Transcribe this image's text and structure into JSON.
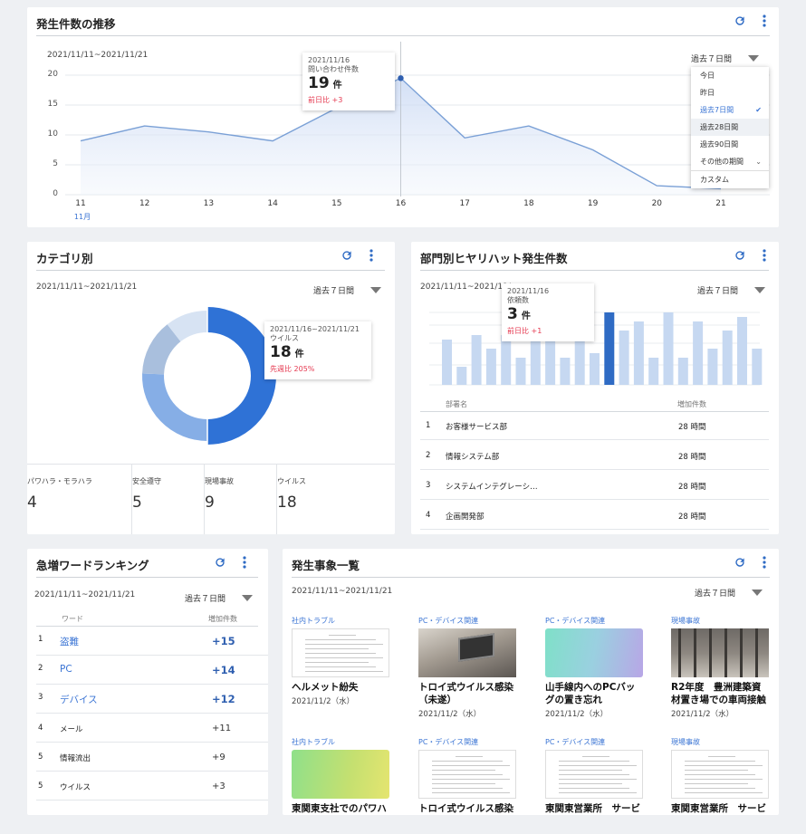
{
  "trend": {
    "title": "発生件数の推移",
    "date_range": "2021/11/11~2021/11/21",
    "period": "過去７日間",
    "y_ticks": [
      "20",
      "15",
      "10",
      "5",
      "0"
    ],
    "x_ticks": [
      "11",
      "12",
      "13",
      "14",
      "15",
      "16",
      "17",
      "18",
      "19",
      "20",
      "21"
    ],
    "x_month": "11月",
    "tooltip": {
      "date": "2021/11/16",
      "label": "問い合わせ件数",
      "value": "19",
      "unit": "件",
      "delta": "前日比 +3"
    },
    "dropdown": [
      {
        "label": "今日",
        "selected": false
      },
      {
        "label": "昨日",
        "selected": false
      },
      {
        "label": "過去7日間",
        "selected": true,
        "mark": "✔"
      },
      {
        "label": "過去28日間",
        "selected": false
      },
      {
        "label": "過去90日間",
        "selected": false
      },
      {
        "label": "その他の期間",
        "selected": false,
        "mark": "⌄"
      },
      {
        "label": "カスタム",
        "selected": false
      }
    ]
  },
  "category": {
    "title": "カテゴリ別",
    "date_range": "2021/11/11~2021/11/21",
    "period": "過去７日間",
    "tooltip": {
      "date": "2021/11/16~2021/11/21",
      "label": "ウイルス",
      "value": "18",
      "unit": "件",
      "delta": "先週比 205%"
    },
    "stats": [
      {
        "label": "パワハラ・モラハラ",
        "value": "4"
      },
      {
        "label": "安全遵守",
        "value": "5"
      },
      {
        "label": "現場事故",
        "value": "9"
      },
      {
        "label": "ウイルス",
        "value": "18"
      }
    ]
  },
  "department": {
    "title": "部門別ヒヤリハット発生件数",
    "date_range": "2021/11/11~2021/11/",
    "period": "過去７日間",
    "tooltip": {
      "date": "2021/11/16",
      "label": "依頼数",
      "value": "3",
      "unit": "件",
      "delta": "前日比 +1"
    },
    "col_name": "部署名",
    "col_count": "増加件数",
    "rows": [
      {
        "rank": "1",
        "name": "お客様サービス部",
        "count": "28 時間"
      },
      {
        "rank": "2",
        "name": "情報システム部",
        "count": "28 時間"
      },
      {
        "rank": "3",
        "name": "システムインテグレーシ…",
        "count": "28 時間"
      },
      {
        "rank": "4",
        "name": "企画開発部",
        "count": "28 時間"
      }
    ]
  },
  "ranking": {
    "title": "急増ワードランキング",
    "date_range": "2021/11/11~2021/11/21",
    "period": "過去７日間",
    "col_word": "ワード",
    "col_count": "増加件数",
    "rows": [
      {
        "rank": "1",
        "word": "盗難",
        "count": "+15",
        "highlight": true
      },
      {
        "rank": "2",
        "word": "PC",
        "count": "+14",
        "highlight": true
      },
      {
        "rank": "3",
        "word": "デバイス",
        "count": "+12",
        "highlight": true
      },
      {
        "rank": "4",
        "word": "メール",
        "count": "+11",
        "highlight": false
      },
      {
        "rank": "5",
        "word": "情報流出",
        "count": "+9",
        "highlight": false
      },
      {
        "rank": "5",
        "word": "ウイルス",
        "count": "+3",
        "highlight": false
      }
    ]
  },
  "events": {
    "title": "発生事象一覧",
    "date_range": "2021/11/11~2021/11/21",
    "period": "過去７日間",
    "items": [
      {
        "category": "社内トラブル",
        "title": "ヘルメット紛失",
        "date": "2021/11/2（水）",
        "thumb": "doc"
      },
      {
        "category": "PC・デバイス関連",
        "title": "トロイ式ウイルス感染（未遂）",
        "date": "2021/11/2（水）",
        "thumb": "photo-desk"
      },
      {
        "category": "PC・デバイス関連",
        "title": "山手線内へのPCバッグの置き忘れ",
        "date": "2021/11/2（水）",
        "thumb": "gradient-teal"
      },
      {
        "category": "現場事故",
        "title": "R2年度　豊洲建築資材置き場での車両接触",
        "date": "2021/11/2（水）",
        "thumb": "photo-building"
      },
      {
        "category": "社内トラブル",
        "title": "東関東支社でのパワハラ事案",
        "date": "",
        "thumb": "gradient-green"
      },
      {
        "category": "PC・デバイス関連",
        "title": "トロイ式ウイルス感染",
        "date": "",
        "thumb": "doc"
      },
      {
        "category": "PC・デバイス関連",
        "title": "東関東営業所　サービス",
        "date": "",
        "thumb": "doc"
      },
      {
        "category": "現場事故",
        "title": "東関東営業所　サービス",
        "date": "",
        "thumb": "doc"
      }
    ]
  },
  "chart_data": [
    {
      "type": "area",
      "x": [
        11,
        12,
        13,
        14,
        15,
        16,
        17,
        18,
        19,
        20,
        21
      ],
      "series": [
        {
          "values": [
            9,
            11.5,
            10.5,
            9,
            14.5,
            19.5,
            9.5,
            11.5,
            7.5,
            1.5,
            1
          ]
        }
      ],
      "ylim": [
        0,
        20
      ],
      "grid": true
    },
    {
      "type": "pie",
      "categories": [
        "パワハラ・モラハラ",
        "安全遵守",
        "現場事故",
        "ウイルス"
      ],
      "values": [
        4,
        5,
        9,
        18
      ]
    },
    {
      "type": "bar",
      "values": [
        5,
        2,
        5.5,
        4,
        5.5,
        3,
        6,
        5,
        3,
        5.5,
        3.5,
        8,
        6,
        7,
        3,
        8,
        3,
        7,
        4,
        6,
        7.5,
        4
      ],
      "highlight_index": 11,
      "grid": true
    }
  ],
  "colors": {
    "accent": "#3a74d4",
    "donut_main": "#2f72d6",
    "donut_2": "#86aee6",
    "donut_3": "#a9bfdd",
    "donut_4": "#d7e3f3",
    "bar": "#c6d8f1",
    "bar_active": "#2f6bc4",
    "delta": "#e53950"
  }
}
